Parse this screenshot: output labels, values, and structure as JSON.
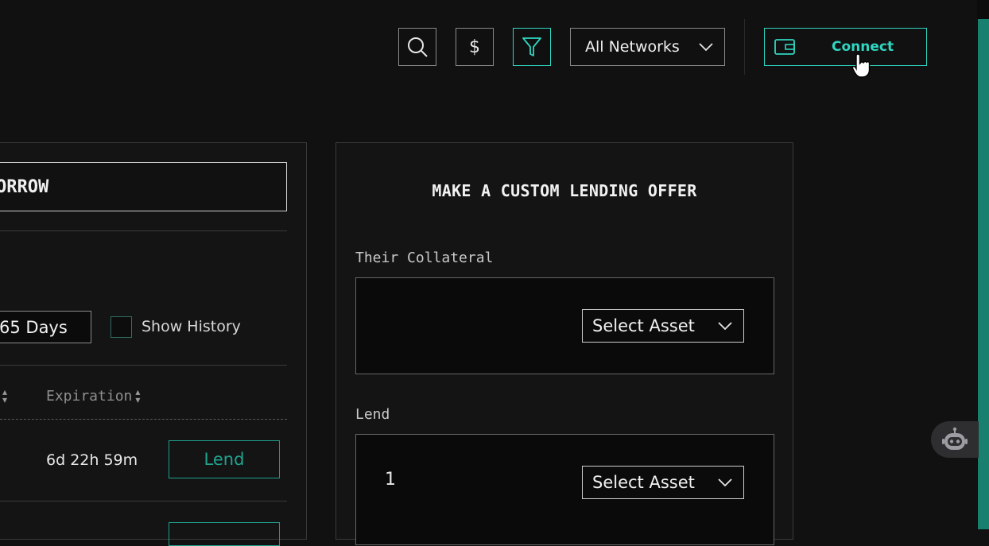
{
  "header": {
    "network_select": "All Networks",
    "connect_label": "Connect",
    "currency_symbol": "$"
  },
  "left_panel": {
    "borrow_tab_label": "ORROW",
    "days_value": "65 Days",
    "show_history_label": "Show History",
    "columns": {
      "expiration": "Expiration"
    },
    "rows": [
      {
        "expiration": "6d 22h 59m",
        "action": "Lend"
      }
    ]
  },
  "offer_panel": {
    "title": "MAKE A CUSTOM LENDING OFFER",
    "collateral_label": "Their Collateral",
    "collateral_select": "Select Asset",
    "lend_label": "Lend",
    "lend_amount": "1",
    "lend_select": "Select Asset"
  },
  "colors": {
    "accent": "#2fd6c0",
    "accent_dark": "#1f9e8c",
    "background": "#111112"
  }
}
